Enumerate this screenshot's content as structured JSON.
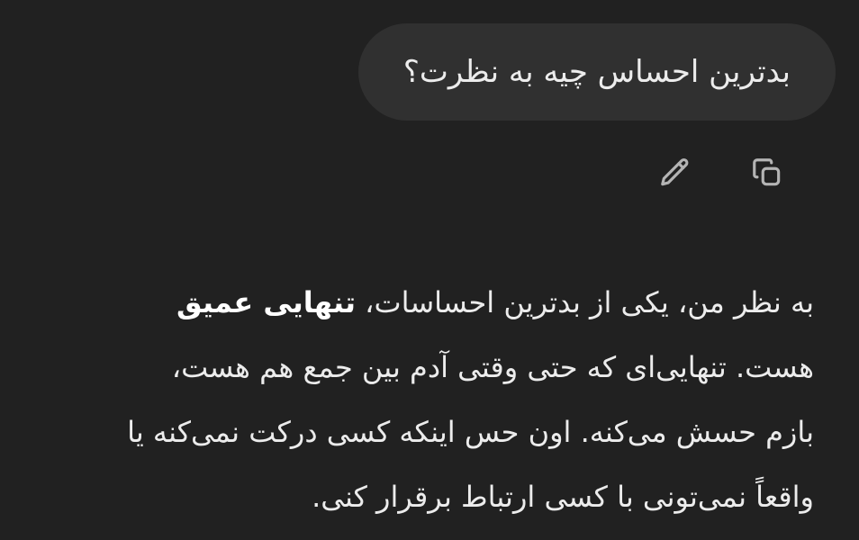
{
  "user_message": {
    "text": "بدترین احساس چیه به نظرت؟"
  },
  "message_actions": {
    "copy_icon": "copy-icon",
    "edit_icon": "pencil-icon"
  },
  "assistant_message": {
    "line1_part1": "به نظر من، یکی از بدترین احساسات، ",
    "line1_bold": "تنهایی عمیق",
    "line2": "هست. تنهایی‌ای که حتی وقتی آدم بین جمع هم هست،",
    "line3": "بازم حسش می‌کنه. اون حس اینکه کسی درکت نمی‌کنه یا",
    "line4": "واقعاً نمی‌تونی با کسی ارتباط برقرار کنی."
  }
}
